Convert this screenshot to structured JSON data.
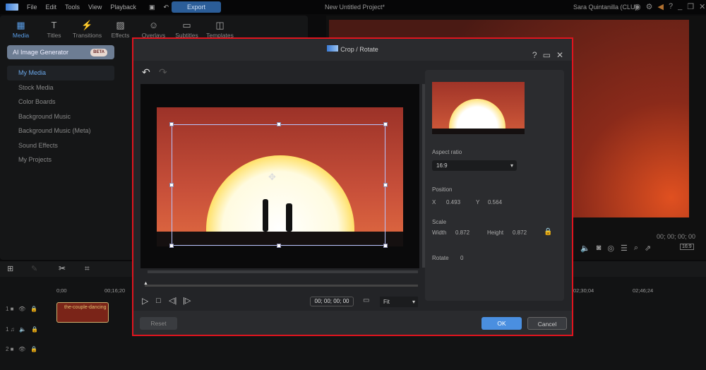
{
  "menubar": {
    "items": [
      "File",
      "Edit",
      "Tools",
      "View",
      "Playback"
    ],
    "export": "Export",
    "title": "New Untitled Project*",
    "user": "Sara Quintanilla (CLU)"
  },
  "tabs": [
    {
      "icon": "media-icon",
      "label": "Media"
    },
    {
      "icon": "titles-icon",
      "label": "Titles"
    },
    {
      "icon": "transitions-icon",
      "label": "Transitions"
    },
    {
      "icon": "effects-icon",
      "label": "Effects"
    },
    {
      "icon": "overlays-icon",
      "label": "Overlays"
    },
    {
      "icon": "subtitles-icon",
      "label": "Subtitles"
    },
    {
      "icon": "templates-icon",
      "label": "Templates"
    }
  ],
  "ai_generator": {
    "label": "AI Image Generator",
    "badge": "BETA"
  },
  "sidebar": [
    "My Media",
    "Stock Media",
    "Color Boards",
    "Background Music",
    "Background Music (Meta)",
    "Sound Effects",
    "My Projects"
  ],
  "preview": {
    "time": "00; 00; 00; 00",
    "ratio": "16:9"
  },
  "timeline": {
    "start": "0;00",
    "t1": "00;16;20",
    "t2": "02;30;04",
    "t3": "02;46;24",
    "clip": "the-couple-dancing",
    "tracks": [
      "1",
      "1",
      "2"
    ]
  },
  "dialog": {
    "title": "Crop / Rotate",
    "timecode": "00; 00; 00; 00",
    "zoom": "Fit",
    "aspect_label": "Aspect ratio",
    "aspect": "16:9",
    "position_label": "Position",
    "x_label": "X",
    "x": "0.493",
    "y_label": "Y",
    "y": "0.564",
    "scale_label": "Scale",
    "width_label": "Width",
    "width": "0.872",
    "height_label": "Height",
    "height": "0.872",
    "rotate_label": "Rotate",
    "rotate": "0",
    "reset": "Reset",
    "ok": "OK",
    "cancel": "Cancel"
  },
  "colors": {
    "accent": "#4a8fe0",
    "highlight": "#e0141e"
  }
}
